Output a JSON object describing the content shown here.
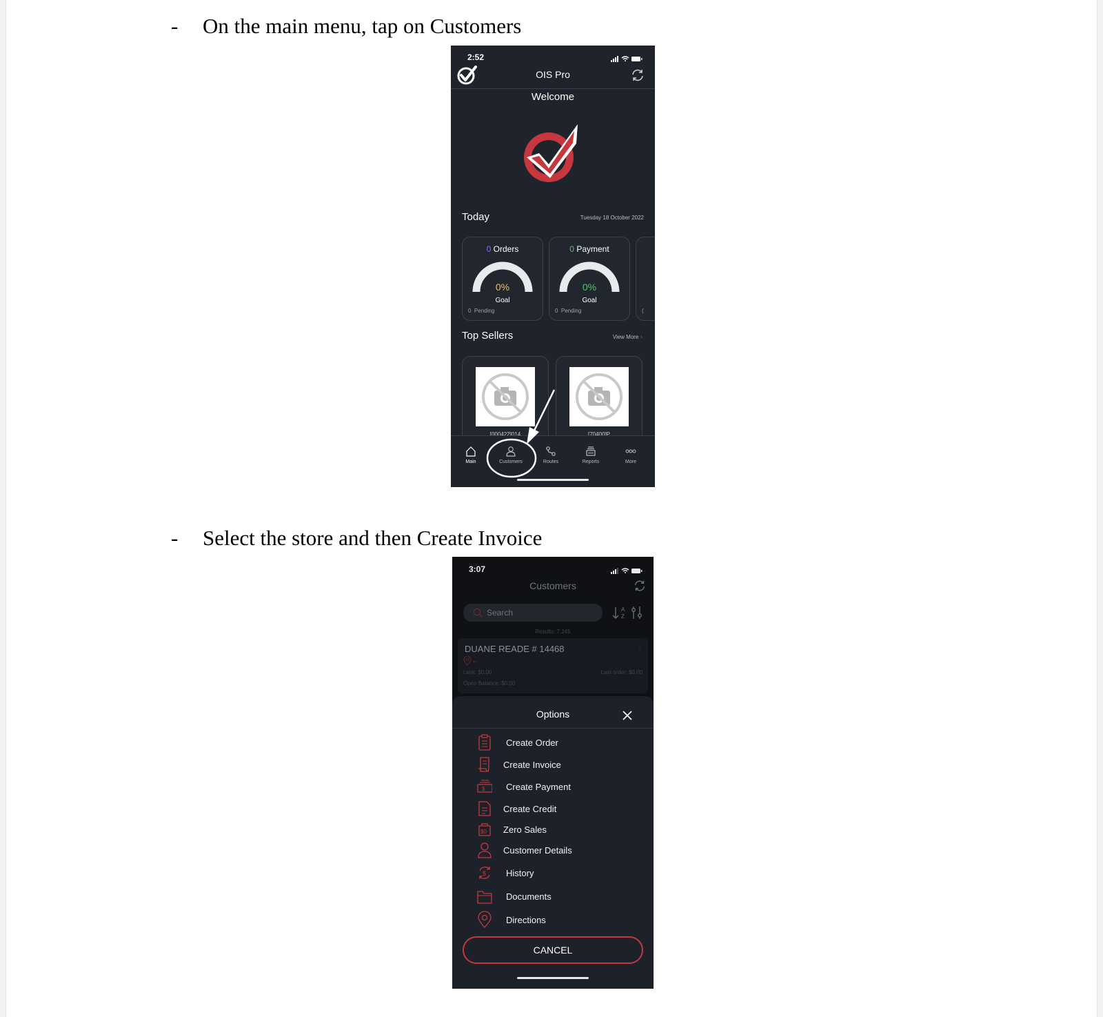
{
  "steps": [
    {
      "bullet": "-",
      "text": "On the main menu, tap on Customers"
    },
    {
      "bullet": "-",
      "text": "Select the store and then Create Invoice"
    }
  ],
  "screen1": {
    "time": "2:52",
    "title": "OIS Pro",
    "welcome": "Welcome",
    "today_label": "Today",
    "today_date": "Tuesday 18 October 2022",
    "cards": [
      {
        "count": "0",
        "label": "Orders",
        "percent_text": "0%",
        "percent": 0,
        "goal": "Goal",
        "pending_count": "0",
        "pending_label": "Pending",
        "count_color": "#7b74f0",
        "percent_color": "#e6c07a"
      },
      {
        "count": "0",
        "label": "Payment",
        "percent_text": "0%",
        "percent": 0,
        "goal": "Goal",
        "pending_count": "0",
        "pending_label": "Pending",
        "count_color": "#58c46c",
        "percent_color": "#58c46c"
      }
    ],
    "card3_peek": "(",
    "top_sellers": "Top Sellers",
    "view_more": "View More",
    "seller_codes": [
      "[000422]014",
      "[70400]P"
    ],
    "tabs": [
      {
        "label": "Main",
        "icon": "home-icon"
      },
      {
        "label": "Customers",
        "icon": "person-icon"
      },
      {
        "label": "Routes",
        "icon": "route-icon"
      },
      {
        "label": "Reports",
        "icon": "reports-icon"
      },
      {
        "label": "More",
        "icon": "more-icon"
      }
    ],
    "colors": {
      "accent": "#c6383d",
      "bg": "#1f232b"
    }
  },
  "screen2": {
    "time": "3:07",
    "title": "Customers",
    "search_placeholder": "Search",
    "results": "Results: 7,245",
    "customer": {
      "name": "DUANE READE # 14468",
      "address": ",,",
      "limit": "Limit: $0.00",
      "last_order": "Last order: $0.00",
      "open_balance": "Open Balance: $0.00"
    },
    "options_title": "Options",
    "options": [
      {
        "label": "Create Order",
        "icon": "clipboard-list-icon"
      },
      {
        "label": "Create Invoice",
        "icon": "receipt-icon"
      },
      {
        "label": "Create Payment",
        "icon": "cash-icon"
      },
      {
        "label": "Create Credit",
        "icon": "credit-document-icon"
      },
      {
        "label": "Zero Sales",
        "icon": "zero-sales-icon"
      },
      {
        "label": "Customer Details",
        "icon": "person-icon"
      },
      {
        "label": "History",
        "icon": "history-dollar-icon"
      },
      {
        "label": "Documents",
        "icon": "folder-icon"
      },
      {
        "label": "Directions",
        "icon": "map-pin-icon"
      }
    ],
    "cancel": "CANCEL"
  }
}
